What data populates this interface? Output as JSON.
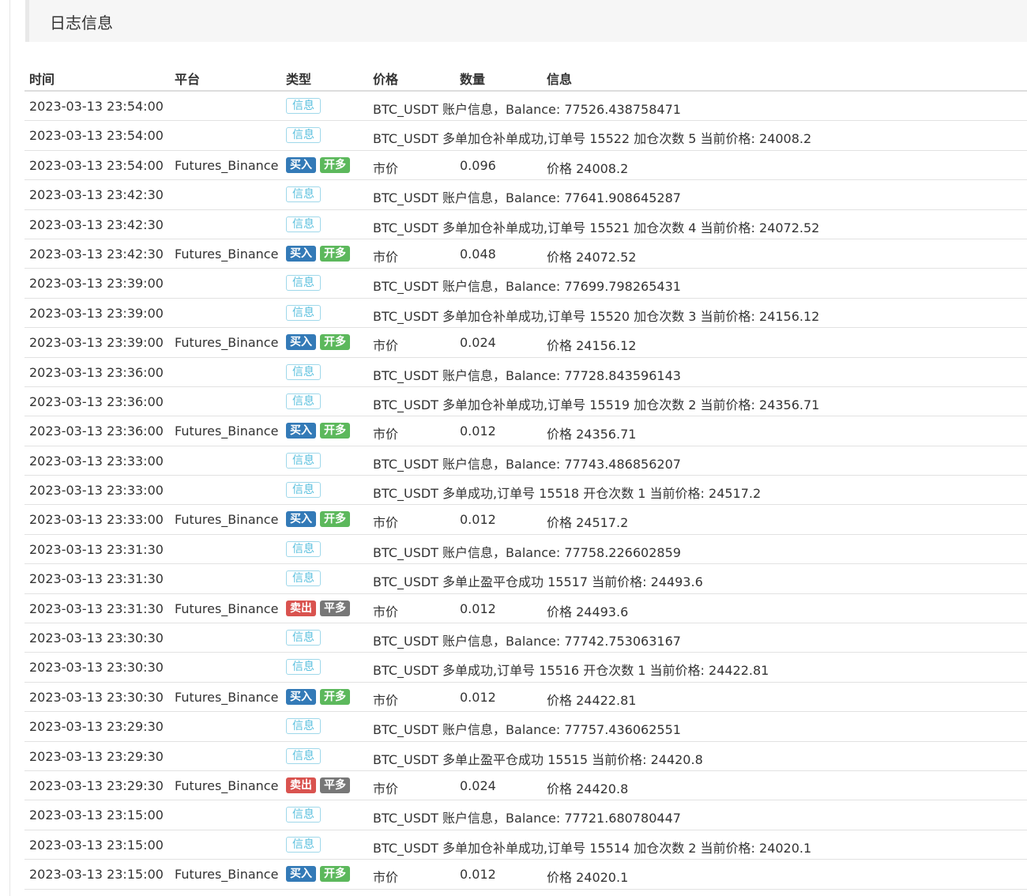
{
  "panel": {
    "title": "日志信息"
  },
  "colors": {
    "buy": "#337ab7",
    "sell": "#d9534f",
    "open_long": "#5cb85c",
    "close_long": "#777777",
    "info": "#5bc0de"
  },
  "labels": {
    "info": "信息",
    "buy": "买入",
    "sell": "卖出",
    "open_long": "开多",
    "close_long": "平多"
  },
  "table": {
    "headers": [
      "时间",
      "平台",
      "类型",
      "价格",
      "数量",
      "信息"
    ],
    "rows": [
      {
        "time": "2023-03-13 23:54:00",
        "platform": "",
        "kind": "info",
        "price": "",
        "amount": "",
        "message": "BTC_USDT 账户信息，Balance: 77526.438758471"
      },
      {
        "time": "2023-03-13 23:54:00",
        "platform": "",
        "kind": "info",
        "price": "",
        "amount": "",
        "message": "BTC_USDT 多单加仓补单成功,订单号 15522 加仓次数 5 当前价格: 24008.2"
      },
      {
        "time": "2023-03-13 23:54:00",
        "platform": "Futures_Binance",
        "kind": "buy",
        "price": "市价",
        "amount": "0.096",
        "message": "价格 24008.2"
      },
      {
        "time": "2023-03-13 23:42:30",
        "platform": "",
        "kind": "info",
        "price": "",
        "amount": "",
        "message": "BTC_USDT 账户信息，Balance: 77641.908645287"
      },
      {
        "time": "2023-03-13 23:42:30",
        "platform": "",
        "kind": "info",
        "price": "",
        "amount": "",
        "message": "BTC_USDT 多单加仓补单成功,订单号 15521 加仓次数 4 当前价格: 24072.52"
      },
      {
        "time": "2023-03-13 23:42:30",
        "platform": "Futures_Binance",
        "kind": "buy",
        "price": "市价",
        "amount": "0.048",
        "message": "价格 24072.52"
      },
      {
        "time": "2023-03-13 23:39:00",
        "platform": "",
        "kind": "info",
        "price": "",
        "amount": "",
        "message": "BTC_USDT 账户信息，Balance: 77699.798265431"
      },
      {
        "time": "2023-03-13 23:39:00",
        "platform": "",
        "kind": "info",
        "price": "",
        "amount": "",
        "message": "BTC_USDT 多单加仓补单成功,订单号 15520 加仓次数 3 当前价格: 24156.12"
      },
      {
        "time": "2023-03-13 23:39:00",
        "platform": "Futures_Binance",
        "kind": "buy",
        "price": "市价",
        "amount": "0.024",
        "message": "价格 24156.12"
      },
      {
        "time": "2023-03-13 23:36:00",
        "platform": "",
        "kind": "info",
        "price": "",
        "amount": "",
        "message": "BTC_USDT 账户信息，Balance: 77728.843596143"
      },
      {
        "time": "2023-03-13 23:36:00",
        "platform": "",
        "kind": "info",
        "price": "",
        "amount": "",
        "message": "BTC_USDT 多单加仓补单成功,订单号 15519 加仓次数 2 当前价格: 24356.71"
      },
      {
        "time": "2023-03-13 23:36:00",
        "platform": "Futures_Binance",
        "kind": "buy",
        "price": "市价",
        "amount": "0.012",
        "message": "价格 24356.71"
      },
      {
        "time": "2023-03-13 23:33:00",
        "platform": "",
        "kind": "info",
        "price": "",
        "amount": "",
        "message": "BTC_USDT 账户信息，Balance: 77743.486856207"
      },
      {
        "time": "2023-03-13 23:33:00",
        "platform": "",
        "kind": "info",
        "price": "",
        "amount": "",
        "message": "BTC_USDT 多单成功,订单号 15518 开仓次数 1 当前价格: 24517.2"
      },
      {
        "time": "2023-03-13 23:33:00",
        "platform": "Futures_Binance",
        "kind": "buy",
        "price": "市价",
        "amount": "0.012",
        "message": "价格 24517.2"
      },
      {
        "time": "2023-03-13 23:31:30",
        "platform": "",
        "kind": "info",
        "price": "",
        "amount": "",
        "message": "BTC_USDT 账户信息，Balance: 77758.226602859"
      },
      {
        "time": "2023-03-13 23:31:30",
        "platform": "",
        "kind": "info",
        "price": "",
        "amount": "",
        "message": "BTC_USDT 多单止盈平仓成功 15517 当前价格: 24493.6"
      },
      {
        "time": "2023-03-13 23:31:30",
        "platform": "Futures_Binance",
        "kind": "sell",
        "price": "市价",
        "amount": "0.012",
        "message": "价格 24493.6"
      },
      {
        "time": "2023-03-13 23:30:30",
        "platform": "",
        "kind": "info",
        "price": "",
        "amount": "",
        "message": "BTC_USDT 账户信息，Balance: 77742.753063167"
      },
      {
        "time": "2023-03-13 23:30:30",
        "platform": "",
        "kind": "info",
        "price": "",
        "amount": "",
        "message": "BTC_USDT 多单成功,订单号 15516 开仓次数 1 当前价格: 24422.81"
      },
      {
        "time": "2023-03-13 23:30:30",
        "platform": "Futures_Binance",
        "kind": "buy",
        "price": "市价",
        "amount": "0.012",
        "message": "价格 24422.81"
      },
      {
        "time": "2023-03-13 23:29:30",
        "platform": "",
        "kind": "info",
        "price": "",
        "amount": "",
        "message": "BTC_USDT 账户信息，Balance: 77757.436062551"
      },
      {
        "time": "2023-03-13 23:29:30",
        "platform": "",
        "kind": "info",
        "price": "",
        "amount": "",
        "message": "BTC_USDT 多单止盈平仓成功 15515 当前价格: 24420.8"
      },
      {
        "time": "2023-03-13 23:29:30",
        "platform": "Futures_Binance",
        "kind": "sell",
        "price": "市价",
        "amount": "0.024",
        "message": "价格 24420.8"
      },
      {
        "time": "2023-03-13 23:15:00",
        "platform": "",
        "kind": "info",
        "price": "",
        "amount": "",
        "message": "BTC_USDT 账户信息，Balance: 77721.680780447"
      },
      {
        "time": "2023-03-13 23:15:00",
        "platform": "",
        "kind": "info",
        "price": "",
        "amount": "",
        "message": "BTC_USDT 多单加仓补单成功,订单号 15514 加仓次数 2 当前价格: 24020.1"
      },
      {
        "time": "2023-03-13 23:15:00",
        "platform": "Futures_Binance",
        "kind": "buy",
        "price": "市价",
        "amount": "0.012",
        "message": "价格 24020.1"
      }
    ]
  }
}
